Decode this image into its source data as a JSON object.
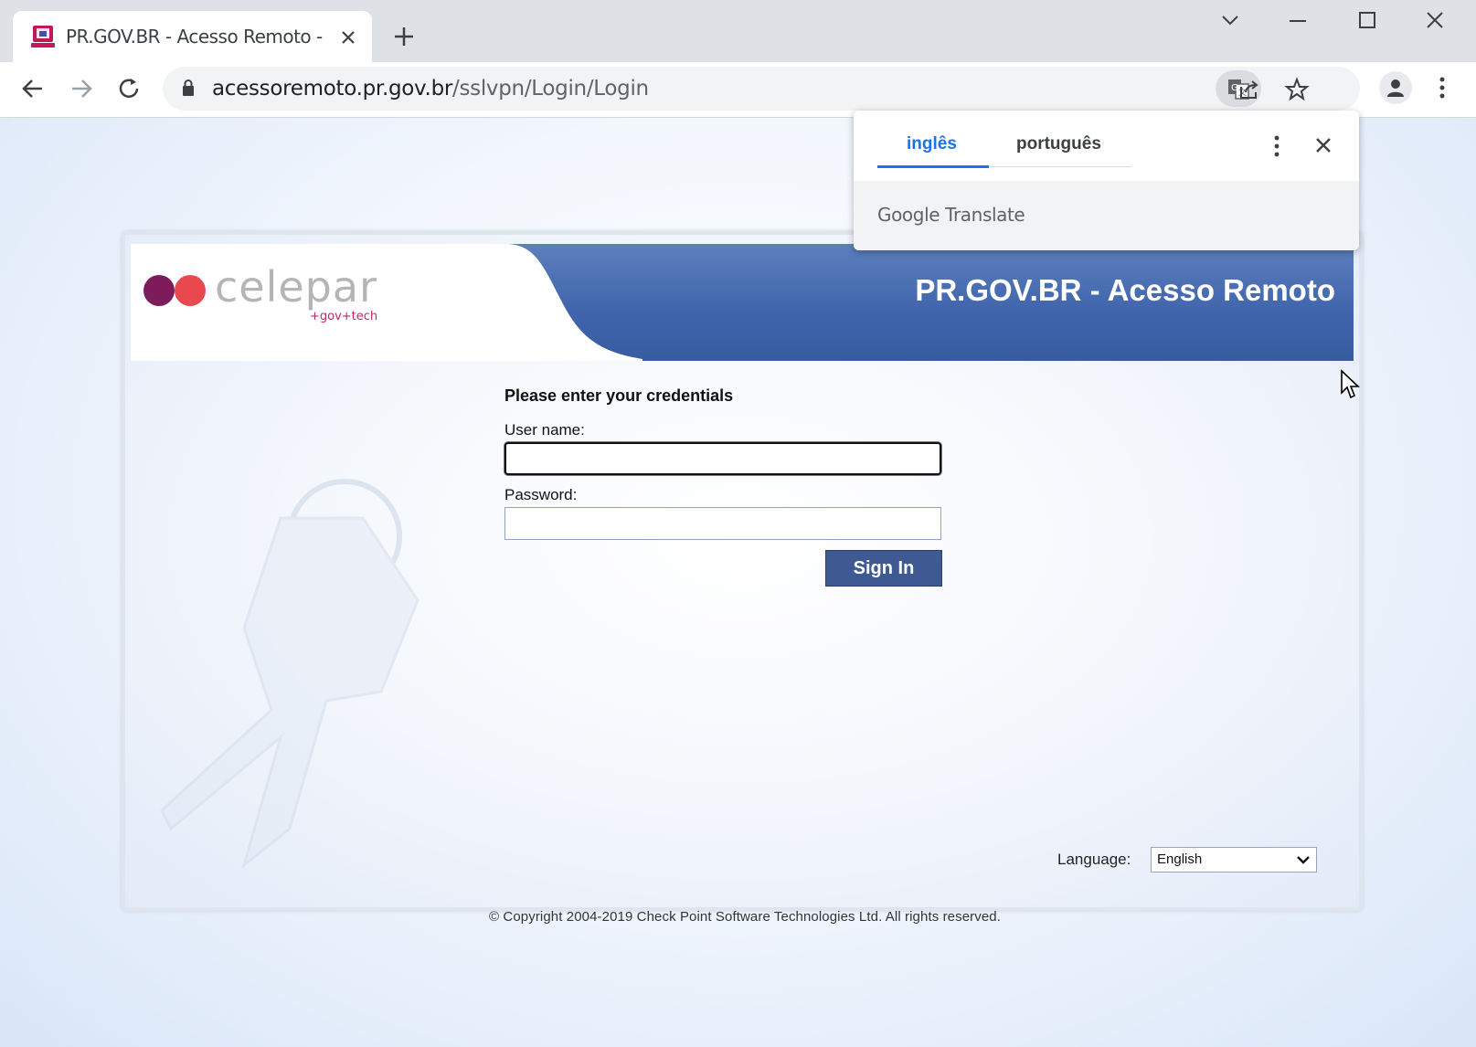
{
  "browser": {
    "tab_title": "PR.GOV.BR - Acesso Remoto - Si",
    "url_host": "acessoremoto.pr.gov.br",
    "url_path": "/sslvpn/Login/Login"
  },
  "translate_popup": {
    "tabs": [
      "inglês",
      "português"
    ],
    "active_tab": "inglês",
    "footer_brand": "Google",
    "footer_product": "Translate"
  },
  "banner": {
    "logo_text": "celepar",
    "logo_tagline": "+gov+tech",
    "title": "PR.GOV.BR - Acesso Remoto"
  },
  "login_form": {
    "heading": "Please enter your credentials",
    "username_label": "User name:",
    "username_value": "",
    "password_label": "Password:",
    "password_value": "",
    "signin_label": "Sign In"
  },
  "language": {
    "label": "Language:",
    "selected": "English"
  },
  "footer": {
    "copyright": "© Copyright 2004-2019   Check Point Software Technologies Ltd. All rights reserved."
  },
  "colors": {
    "banner": "#4064ac",
    "signin_button": "#3f5a93",
    "translate_active": "#1a73e8",
    "logo_dot_purple": "#7e1b5b",
    "logo_dot_red": "#e8484e"
  }
}
